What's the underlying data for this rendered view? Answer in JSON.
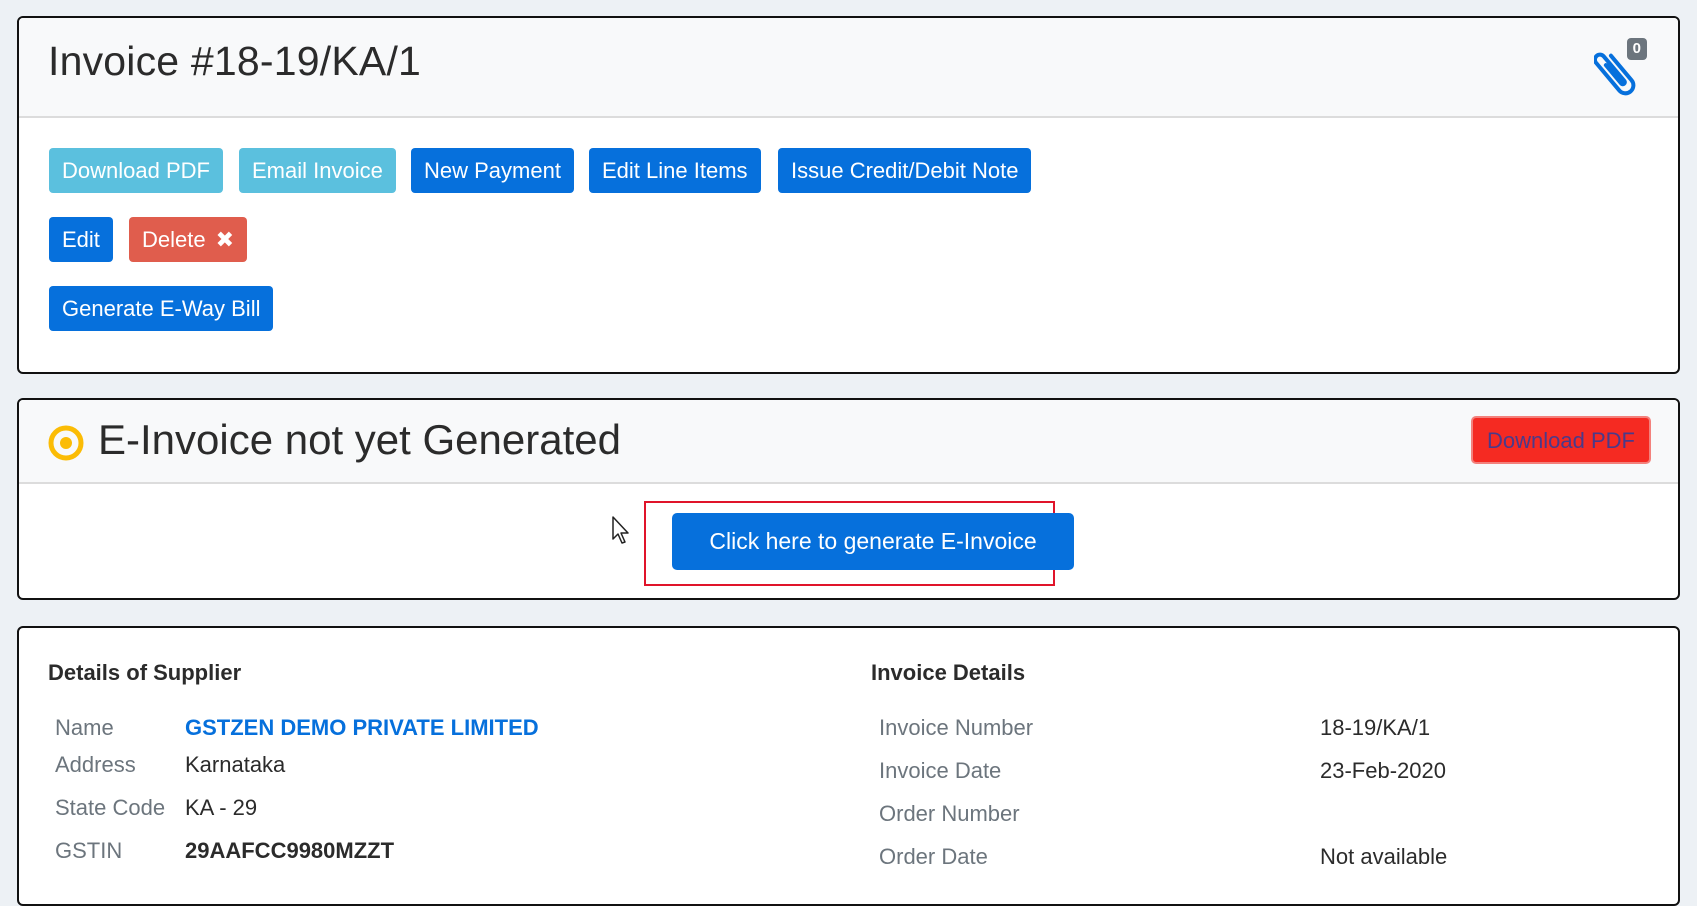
{
  "invoice_card": {
    "title": "Invoice #18-19/KA/1",
    "attachments_count": "0",
    "attachments_icon": "paperclip-icon",
    "buttons": {
      "download_pdf": "Download PDF",
      "email_invoice": "Email Invoice",
      "new_payment": "New Payment",
      "edit_line_items": "Edit Line Items",
      "issue_note": "Issue Credit/Debit Note",
      "edit": "Edit",
      "delete": "Delete",
      "delete_icon": "✖",
      "generate_eway": "Generate E-Way Bill"
    }
  },
  "einvoice_card": {
    "status_icon": "dot-circle-icon",
    "status_title": "E-Invoice not yet Generated",
    "status_color": "#fbbc05",
    "download_pdf": "Download PDF",
    "generate_button": "Click here to generate E-Invoice"
  },
  "details_card": {
    "supplier": {
      "title": "Details of Supplier",
      "rows": [
        {
          "label": "Name",
          "value": "GSTZEN DEMO PRIVATE LIMITED"
        },
        {
          "label": "Address",
          "value": "Karnataka"
        },
        {
          "label": "State Code",
          "value": "KA - 29"
        },
        {
          "label": "GSTIN",
          "value": "29AAFCC9980MZZT"
        }
      ]
    },
    "invoice": {
      "title": "Invoice Details",
      "rows": [
        {
          "label": "Invoice Number",
          "value": "18-19/KA/1"
        },
        {
          "label": "Invoice Date",
          "value": "23-Feb-2020"
        },
        {
          "label": "Order Number",
          "value": ""
        },
        {
          "label": "Order Date",
          "value": "Not available"
        }
      ]
    }
  },
  "colors": {
    "primary": "#0670dc",
    "info": "#5bc0de",
    "danger": "#e05d4d",
    "highlight": "#e0142a"
  }
}
